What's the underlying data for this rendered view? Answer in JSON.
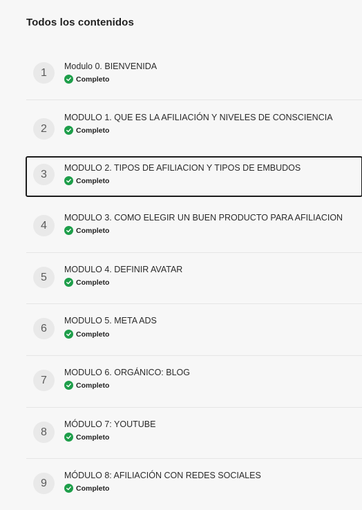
{
  "section": {
    "title": "Todos los contenidos"
  },
  "status_label": "Completo",
  "colors": {
    "complete_green": "#1e9e4a",
    "active_border": "#1c1c1c",
    "badge_bg": "#e9e9e9"
  },
  "modules": [
    {
      "number": "1",
      "title": "Modulo 0. BIENVENIDA",
      "status": "Completo"
    },
    {
      "number": "2",
      "title": "MODULO 1. QUE ES LA AFILIACIÓN Y NIVELES DE CONSCIENCIA",
      "status": "Completo"
    },
    {
      "number": "3",
      "title": "MODULO 2. TIPOS DE AFILIACION Y TIPOS DE EMBUDOS",
      "status": "Completo",
      "active": true
    },
    {
      "number": "4",
      "title": "MODULO 3. COMO ELEGIR UN BUEN PRODUCTO PARA AFILIACION",
      "status": "Completo"
    },
    {
      "number": "5",
      "title": "MODULO 4. DEFINIR AVATAR",
      "status": "Completo"
    },
    {
      "number": "6",
      "title": "MODULO 5. META ADS",
      "status": "Completo"
    },
    {
      "number": "7",
      "title": "MODULO 6. ORGÁNICO: BLOG",
      "status": "Completo"
    },
    {
      "number": "8",
      "title": "MÓDULO 7: YOUTUBE",
      "status": "Completo"
    },
    {
      "number": "9",
      "title": "MÓDULO 8: AFILIACIÓN CON REDES SOCIALES",
      "status": "Completo"
    }
  ]
}
